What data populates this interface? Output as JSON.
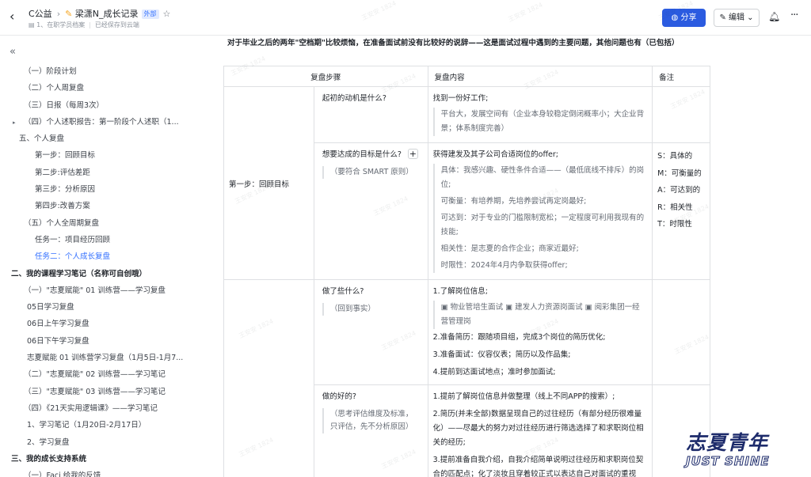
{
  "header": {
    "parent": "C公益",
    "title": "梁潇N_成长记录",
    "tag": "外部",
    "sub_path": "1、在职学员档案",
    "save_status": "已经保存到云端",
    "share_label": "分享",
    "edit_label": "编辑"
  },
  "toc": [
    {
      "label": "（一）阶段计划",
      "indent": 30,
      "style": ""
    },
    {
      "label": "（二）个人周复盘",
      "indent": 30,
      "style": ""
    },
    {
      "label": "（三）日报（每周3次）",
      "indent": 30,
      "style": ""
    },
    {
      "label": "（四）个人述职报告：第一阶段个人述职（1...",
      "indent": 30,
      "style": "",
      "caret": true
    },
    {
      "label": "五、个人复盘",
      "indent": 24,
      "style": ""
    },
    {
      "label": "第一步：回顾目标",
      "indent": 44,
      "style": ""
    },
    {
      "label": "第二步:评估差距",
      "indent": 44,
      "style": ""
    },
    {
      "label": "第三步：分析原因",
      "indent": 44,
      "style": ""
    },
    {
      "label": "第四步:改善方案",
      "indent": 44,
      "style": ""
    },
    {
      "label": "（五）个人全周期复盘",
      "indent": 30,
      "style": ""
    },
    {
      "label": "任务一：项目经历回顾",
      "indent": 44,
      "style": ""
    },
    {
      "label": "任务二：个人成长复盘",
      "indent": 44,
      "style": "active"
    },
    {
      "label": "二、我的课程学习笔记（名称可自创哦）",
      "indent": 14,
      "style": "bold"
    },
    {
      "label": "（一）\"志夏赋能\" 01 训练营——学习复盘",
      "indent": 30,
      "style": ""
    },
    {
      "label": "05日学习复盘",
      "indent": 34,
      "style": ""
    },
    {
      "label": "06日上午学习复盘",
      "indent": 34,
      "style": ""
    },
    {
      "label": "06日下午学习复盘",
      "indent": 34,
      "style": ""
    },
    {
      "label": "志夏赋能 01 训练营学习复盘（1月5日-1月7...",
      "indent": 34,
      "style": ""
    },
    {
      "label": "（二）\"志夏赋能\" 02 训练营——学习笔记",
      "indent": 30,
      "style": ""
    },
    {
      "label": "（三）\"志夏赋能\" 03 训练营——学习笔记",
      "indent": 30,
      "style": ""
    },
    {
      "label": "（四）《21天实用逻辑课》——学习笔记",
      "indent": 30,
      "style": ""
    },
    {
      "label": "1、学习笔记（1月20日-2月17日）",
      "indent": 34,
      "style": ""
    },
    {
      "label": "2、学习复盘",
      "indent": 34,
      "style": ""
    },
    {
      "label": "三、我的成长支持系统",
      "indent": 14,
      "style": "bold"
    },
    {
      "label": "（一）Faci 给我的反馈",
      "indent": 30,
      "style": ""
    }
  ],
  "doc": {
    "intro": "对于毕业之后的两年\"空档期\"比较烦恼，在准备面试前没有比较好的说辞——这是面试过程中遇到的主要问题，其他问题也有（已包括）",
    "col_step": "复盘步骤",
    "col_content": "复盘内容",
    "col_note": "备注",
    "step1": "第一步：回顾目标",
    "r1_q": "起初的动机是什么?",
    "r1_a": "找到一份好工作;",
    "r1_a_quote": "平台大，发展空间有（企业本身较稳定倒闭概率小；大企业背景；体系制度完善）",
    "r2_q": "想要达成的目标是什么?",
    "r2_hint": "（要符合 SMART 原则）",
    "r2_a": "获得建发及其子公司合适岗位的offer;",
    "r2_s": "具体：我感兴趣、硬性条件合适——（最低底线不排斥）的岗位;",
    "r2_m": "可衡量：有培养期，先培养尝试再定岗最好;",
    "r2_a2": "可达到：对于专业的门槛限制宽松；一定程度可利用我现有的技能;",
    "r2_r": "相关性：是志夏的合作企业；商家近最好;",
    "r2_t": "时限性：2024年4月内争取获得offer;",
    "notes": [
      "S：具体的",
      "M：可衡量的",
      "A：可达到的",
      "R：相关性",
      "T：时限性"
    ],
    "r3_q": "做了些什么?",
    "r3_hint": "（回到事实）",
    "r3_1": "1.了解岗位信息;",
    "r3_1_quote": "▣ 物业管培生面试   ▣ 建发人力资源岗面试 ▣ 阅彩集团一经营管理岗",
    "r3_2": "2.准备简历：跟随项目组，完成3个岗位的简历优化;",
    "r3_3": "3.准备面试：仪容仪表；简历以及作品集;",
    "r3_4": "4.提前到达面试地点；准时参加面试;",
    "r4_q": "做的好的?",
    "r4_hint": "（思考评估维度及标准，只评估，先不分析原因）",
    "r4_1": "1.提前了解岗位信息并做整理（线上不同APP的搜索）;",
    "r4_2": "2.简历(并未全部)数据呈现自己的过往经历（有部分经历很难量化）——尽最大的努力对过往经历进行筛选选择了和求职岗位相关的经历;",
    "r4_3": "3.提前准备自我介绍，自我介绍简单说明过往经历和求职岗位契合的匹配点；化了淡妆且穿着较正式以表达自己对面试的重视"
  },
  "logo": {
    "cn": "志夏青年",
    "en": "JUST SHINE"
  },
  "watermark": "王安安 1824"
}
